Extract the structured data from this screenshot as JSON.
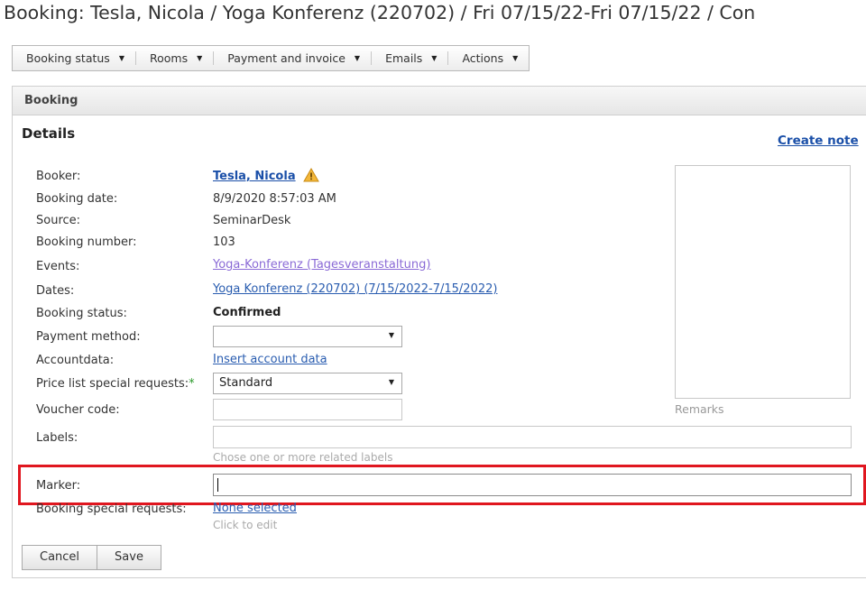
{
  "page_title": "Booking: Tesla, Nicola / Yoga Konferenz (220702) / Fri 07/15/22-Fri 07/15/22 / Con",
  "toolbar": {
    "items": [
      {
        "label": "Booking status"
      },
      {
        "label": "Rooms"
      },
      {
        "label": "Payment and invoice"
      },
      {
        "label": "Emails"
      },
      {
        "label": "Actions"
      }
    ]
  },
  "panel": {
    "header": "Booking",
    "section_title": "Details",
    "create_note": "Create note",
    "remarks_label": "Remarks"
  },
  "fields": {
    "booker": {
      "label": "Booker:",
      "value": "Tesla, Nicola"
    },
    "booking_date": {
      "label": "Booking date:",
      "value": "8/9/2020 8:57:03 AM"
    },
    "source": {
      "label": "Source:",
      "value": "SeminarDesk"
    },
    "booking_number": {
      "label": "Booking number:",
      "value": "103"
    },
    "events": {
      "label": "Events:",
      "value": "Yoga-Konferenz (Tagesveranstaltung)"
    },
    "dates": {
      "label": "Dates:",
      "value": "Yoga Konferenz (220702) (7/15/2022-7/15/2022)"
    },
    "booking_status": {
      "label": "Booking status:",
      "value": "Confirmed"
    },
    "payment_method": {
      "label": "Payment method:",
      "value": ""
    },
    "accountdata": {
      "label": "Accountdata:",
      "value": "Insert account data"
    },
    "price_list": {
      "label": "Price list special requests:",
      "required_mark": "*",
      "value": "Standard"
    },
    "voucher_code": {
      "label": "Voucher code:",
      "value": ""
    },
    "labels": {
      "label": "Labels:",
      "hint": "Chose one or more related labels"
    },
    "marker": {
      "label": "Marker:",
      "value": ""
    },
    "special_requests": {
      "label": "Booking special requests:",
      "value": "None selected",
      "hint": "Click to edit"
    }
  },
  "buttons": {
    "cancel": "Cancel",
    "save": "Save"
  },
  "colors": {
    "highlight": "#e0161f",
    "link": "#2a5db0",
    "visited_link": "#8a6ad6",
    "required": "#2e9b2e"
  }
}
